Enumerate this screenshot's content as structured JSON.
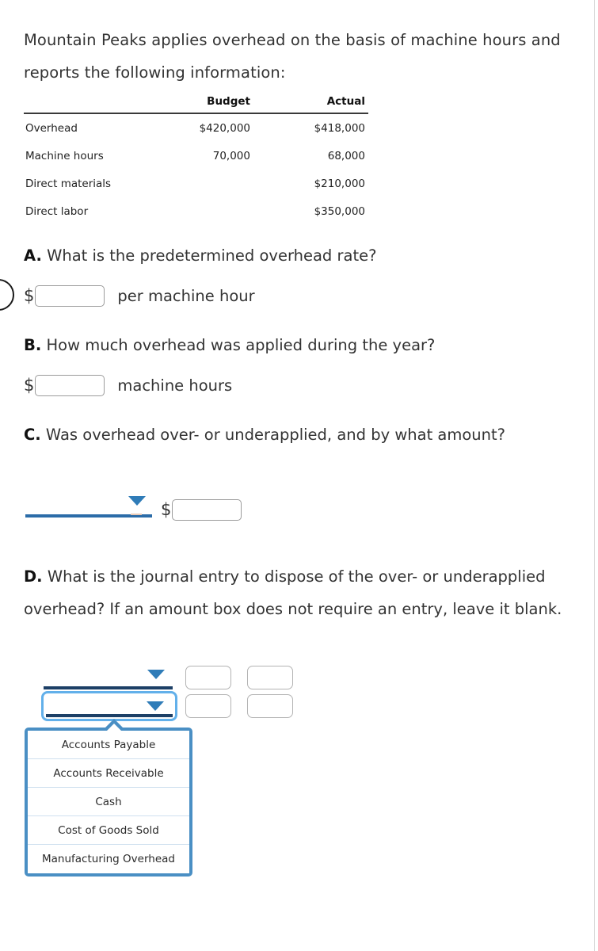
{
  "intro": {
    "text": "Mountain Peaks applies overhead on the basis of machine hours and reports the following information:"
  },
  "table": {
    "columns": [
      "",
      "Budget",
      "Actual"
    ],
    "rows": [
      {
        "label": "Overhead",
        "budget": "$420,000",
        "actual": "$418,000"
      },
      {
        "label": "Machine hours",
        "budget": "70,000",
        "actual": "68,000"
      },
      {
        "label": "Direct materials",
        "budget": "",
        "actual": "$210,000"
      },
      {
        "label": "Direct labor",
        "budget": "",
        "actual": "$350,000"
      }
    ]
  },
  "questions": {
    "a": {
      "letter": "A.",
      "text": "What is the predetermined overhead rate?",
      "currency_symbol": "$",
      "input_value": "",
      "unit_label": "per machine hour"
    },
    "b": {
      "letter": "B.",
      "text": "How much overhead was applied during the year?",
      "currency_symbol": "$",
      "input_value": "",
      "unit_label": "machine hours"
    },
    "c": {
      "letter": "C.",
      "text": "Was overhead over- or underapplied, and by what amount?",
      "select_value": "",
      "currency_symbol": "$",
      "input_value": ""
    },
    "d": {
      "letter": "D.",
      "text": "What is the journal entry to dispose of the over- or underapplied overhead? If an amount box does not require an entry, leave it blank.",
      "rows": [
        {
          "account_value": "",
          "debit_value": "",
          "credit_value": ""
        },
        {
          "account_value": "",
          "debit_value": "",
          "credit_value": ""
        }
      ],
      "dropdown_open": true,
      "dropdown_options": [
        "Accounts Payable",
        "Accounts Receivable",
        "Cash",
        "Cost of Goods Sold",
        "Manufacturing Overhead"
      ]
    }
  },
  "colors": {
    "dropdown_border": "#4a8fc4",
    "focus_glow": "#62b0ea",
    "select_underline_dark": "#1c3f66",
    "select_underline": "#2b6ca8",
    "caret": "#2f7cb8"
  }
}
